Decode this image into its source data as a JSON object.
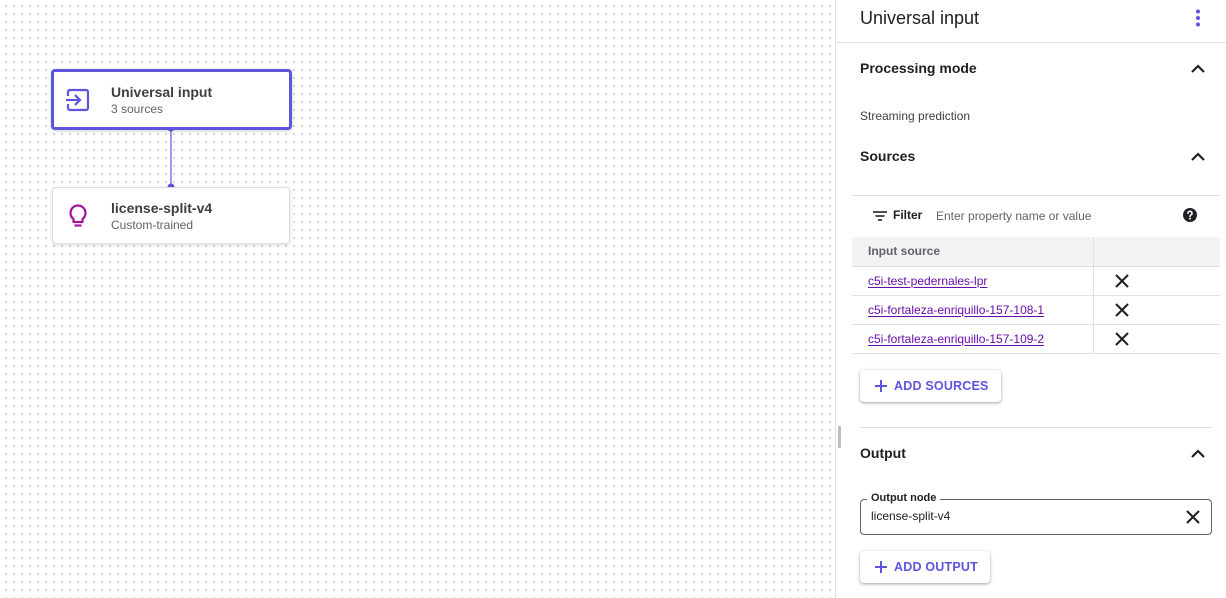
{
  "canvas": {
    "nodes": [
      {
        "title": "Universal input",
        "subtitle": "3 sources",
        "icon": "input-arrow-icon",
        "selected": true
      },
      {
        "title": "license-split-v4",
        "subtitle": "Custom-trained",
        "icon": "lightbulb-icon",
        "selected": false
      }
    ]
  },
  "panel": {
    "title": "Universal input",
    "processing_mode": {
      "heading": "Processing mode",
      "value": "Streaming prediction"
    },
    "sources": {
      "heading": "Sources",
      "filter_label": "Filter",
      "filter_placeholder": "Enter property name or value",
      "column_header": "Input source",
      "rows": [
        "c5i-test-pedernales-lpr",
        "c5i-fortaleza-enriquillo-157-108-1",
        "c5i-fortaleza-enriquillo-157-109-2"
      ],
      "add_button": "ADD SOURCES"
    },
    "output": {
      "heading": "Output",
      "field_label": "Output node",
      "field_value": "license-split-v4",
      "add_button": "ADD OUTPUT"
    }
  },
  "colors": {
    "accent": "#5d55de",
    "link": "#6a0dad",
    "model_icon": "#a0149a"
  }
}
